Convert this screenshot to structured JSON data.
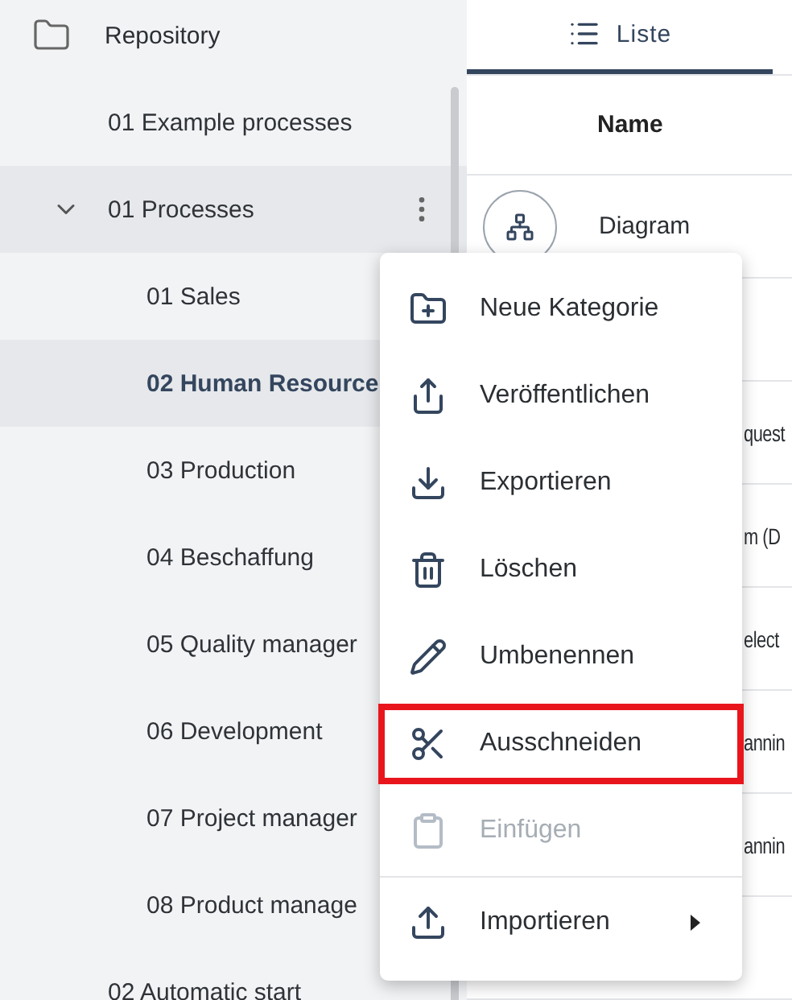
{
  "sidebar": {
    "root": {
      "label": "Repository"
    },
    "items": [
      {
        "label": "01 Example processes",
        "selected": false,
        "hovered": false
      },
      {
        "label": "01 Processes",
        "selected": false,
        "hovered": true,
        "expanded": true,
        "children": [
          {
            "label": "01 Sales",
            "selected": false
          },
          {
            "label": "02 Human Resource",
            "selected": true
          },
          {
            "label": "03 Production",
            "selected": false
          },
          {
            "label": "04 Beschaffung",
            "selected": false
          },
          {
            "label": "05 Quality manager",
            "selected": false
          },
          {
            "label": "06 Development",
            "selected": false
          },
          {
            "label": "07 Project manager",
            "selected": false
          },
          {
            "label": "08 Product manage",
            "selected": false
          }
        ]
      },
      {
        "label": "02 Automatic start",
        "selected": false,
        "hovered": false
      }
    ]
  },
  "tabs": [
    {
      "label": "Liste",
      "selected": true
    }
  ],
  "table": {
    "columns": [
      "Name"
    ],
    "rows": [
      {
        "kind": "diagram",
        "name": "Diagram"
      },
      {
        "kind": "covered"
      },
      {
        "kind": "partial",
        "name": "quest"
      },
      {
        "kind": "partial",
        "name": "m (D"
      },
      {
        "kind": "partial",
        "name": "elect"
      },
      {
        "kind": "partial",
        "name": "annin"
      },
      {
        "kind": "partial",
        "name": "annin"
      },
      {
        "kind": "covered"
      }
    ]
  },
  "context_menu": {
    "items": [
      {
        "kind": "action",
        "label": "Neue Kategorie",
        "disabled": false,
        "highlighted": false
      },
      {
        "kind": "action",
        "label": "Veröffentlichen",
        "disabled": false,
        "highlighted": false
      },
      {
        "kind": "action",
        "label": "Exportieren",
        "disabled": false,
        "highlighted": false
      },
      {
        "kind": "action",
        "label": "Löschen",
        "disabled": false,
        "highlighted": false
      },
      {
        "kind": "action",
        "label": "Umbenennen",
        "disabled": false,
        "highlighted": false
      },
      {
        "kind": "action",
        "label": "Ausschneiden",
        "disabled": false,
        "highlighted": true
      },
      {
        "kind": "action",
        "label": "Einfügen",
        "disabled": true,
        "highlighted": false
      },
      {
        "kind": "divider"
      },
      {
        "kind": "submenu",
        "label": "Importieren",
        "disabled": false,
        "highlighted": false
      }
    ]
  }
}
